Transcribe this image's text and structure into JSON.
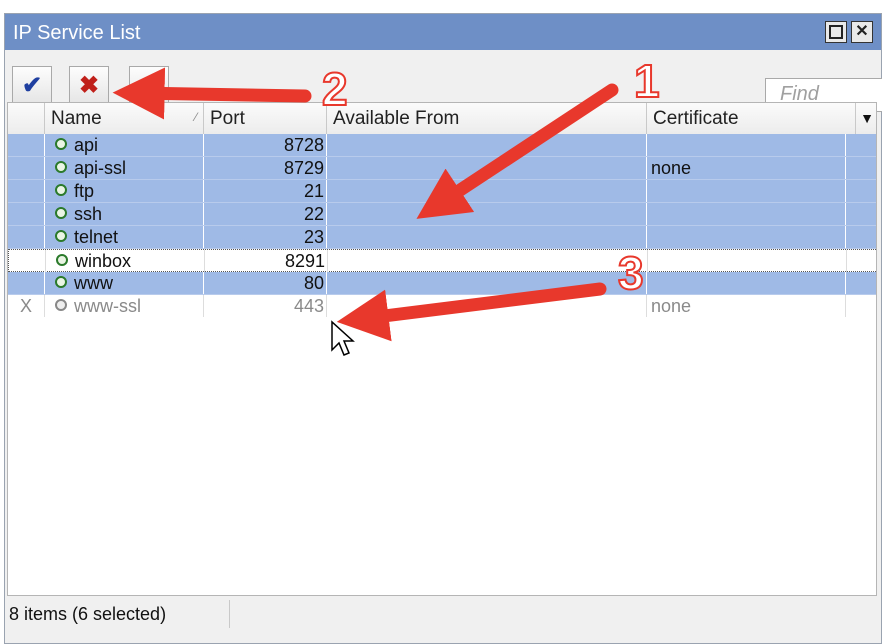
{
  "window": {
    "title": "IP Service List",
    "restore_icon": "restore-icon",
    "close_icon": "close-icon"
  },
  "toolbar": {
    "enable_icon": "checkmark-icon",
    "disable_icon": "x-icon",
    "find_placeholder": "Find"
  },
  "table": {
    "columns": [
      "Name",
      "Port",
      "Available From",
      "Certificate"
    ],
    "rows": [
      {
        "flag": "",
        "name": "api",
        "port": "8728",
        "available_from": "",
        "certificate": ""
      },
      {
        "flag": "",
        "name": "api-ssl",
        "port": "8729",
        "available_from": "",
        "certificate": "none"
      },
      {
        "flag": "",
        "name": "ftp",
        "port": "21",
        "available_from": "",
        "certificate": ""
      },
      {
        "flag": "",
        "name": "ssh",
        "port": "22",
        "available_from": "",
        "certificate": ""
      },
      {
        "flag": "",
        "name": "telnet",
        "port": "23",
        "available_from": "",
        "certificate": ""
      },
      {
        "flag": "",
        "name": "winbox",
        "port": "8291",
        "available_from": "",
        "certificate": ""
      },
      {
        "flag": "",
        "name": "www",
        "port": "80",
        "available_from": "",
        "certificate": ""
      },
      {
        "flag": "X",
        "name": "www-ssl",
        "port": "443",
        "available_from": "",
        "certificate": "none"
      }
    ]
  },
  "status": {
    "text": "8 items (6 selected)"
  },
  "annotations": {
    "arrow_color": "#e8382c",
    "labels": [
      "1",
      "2",
      "3"
    ]
  },
  "colors": {
    "titlebar": "#6e8fc6",
    "selected_row": "#9fbae6"
  }
}
